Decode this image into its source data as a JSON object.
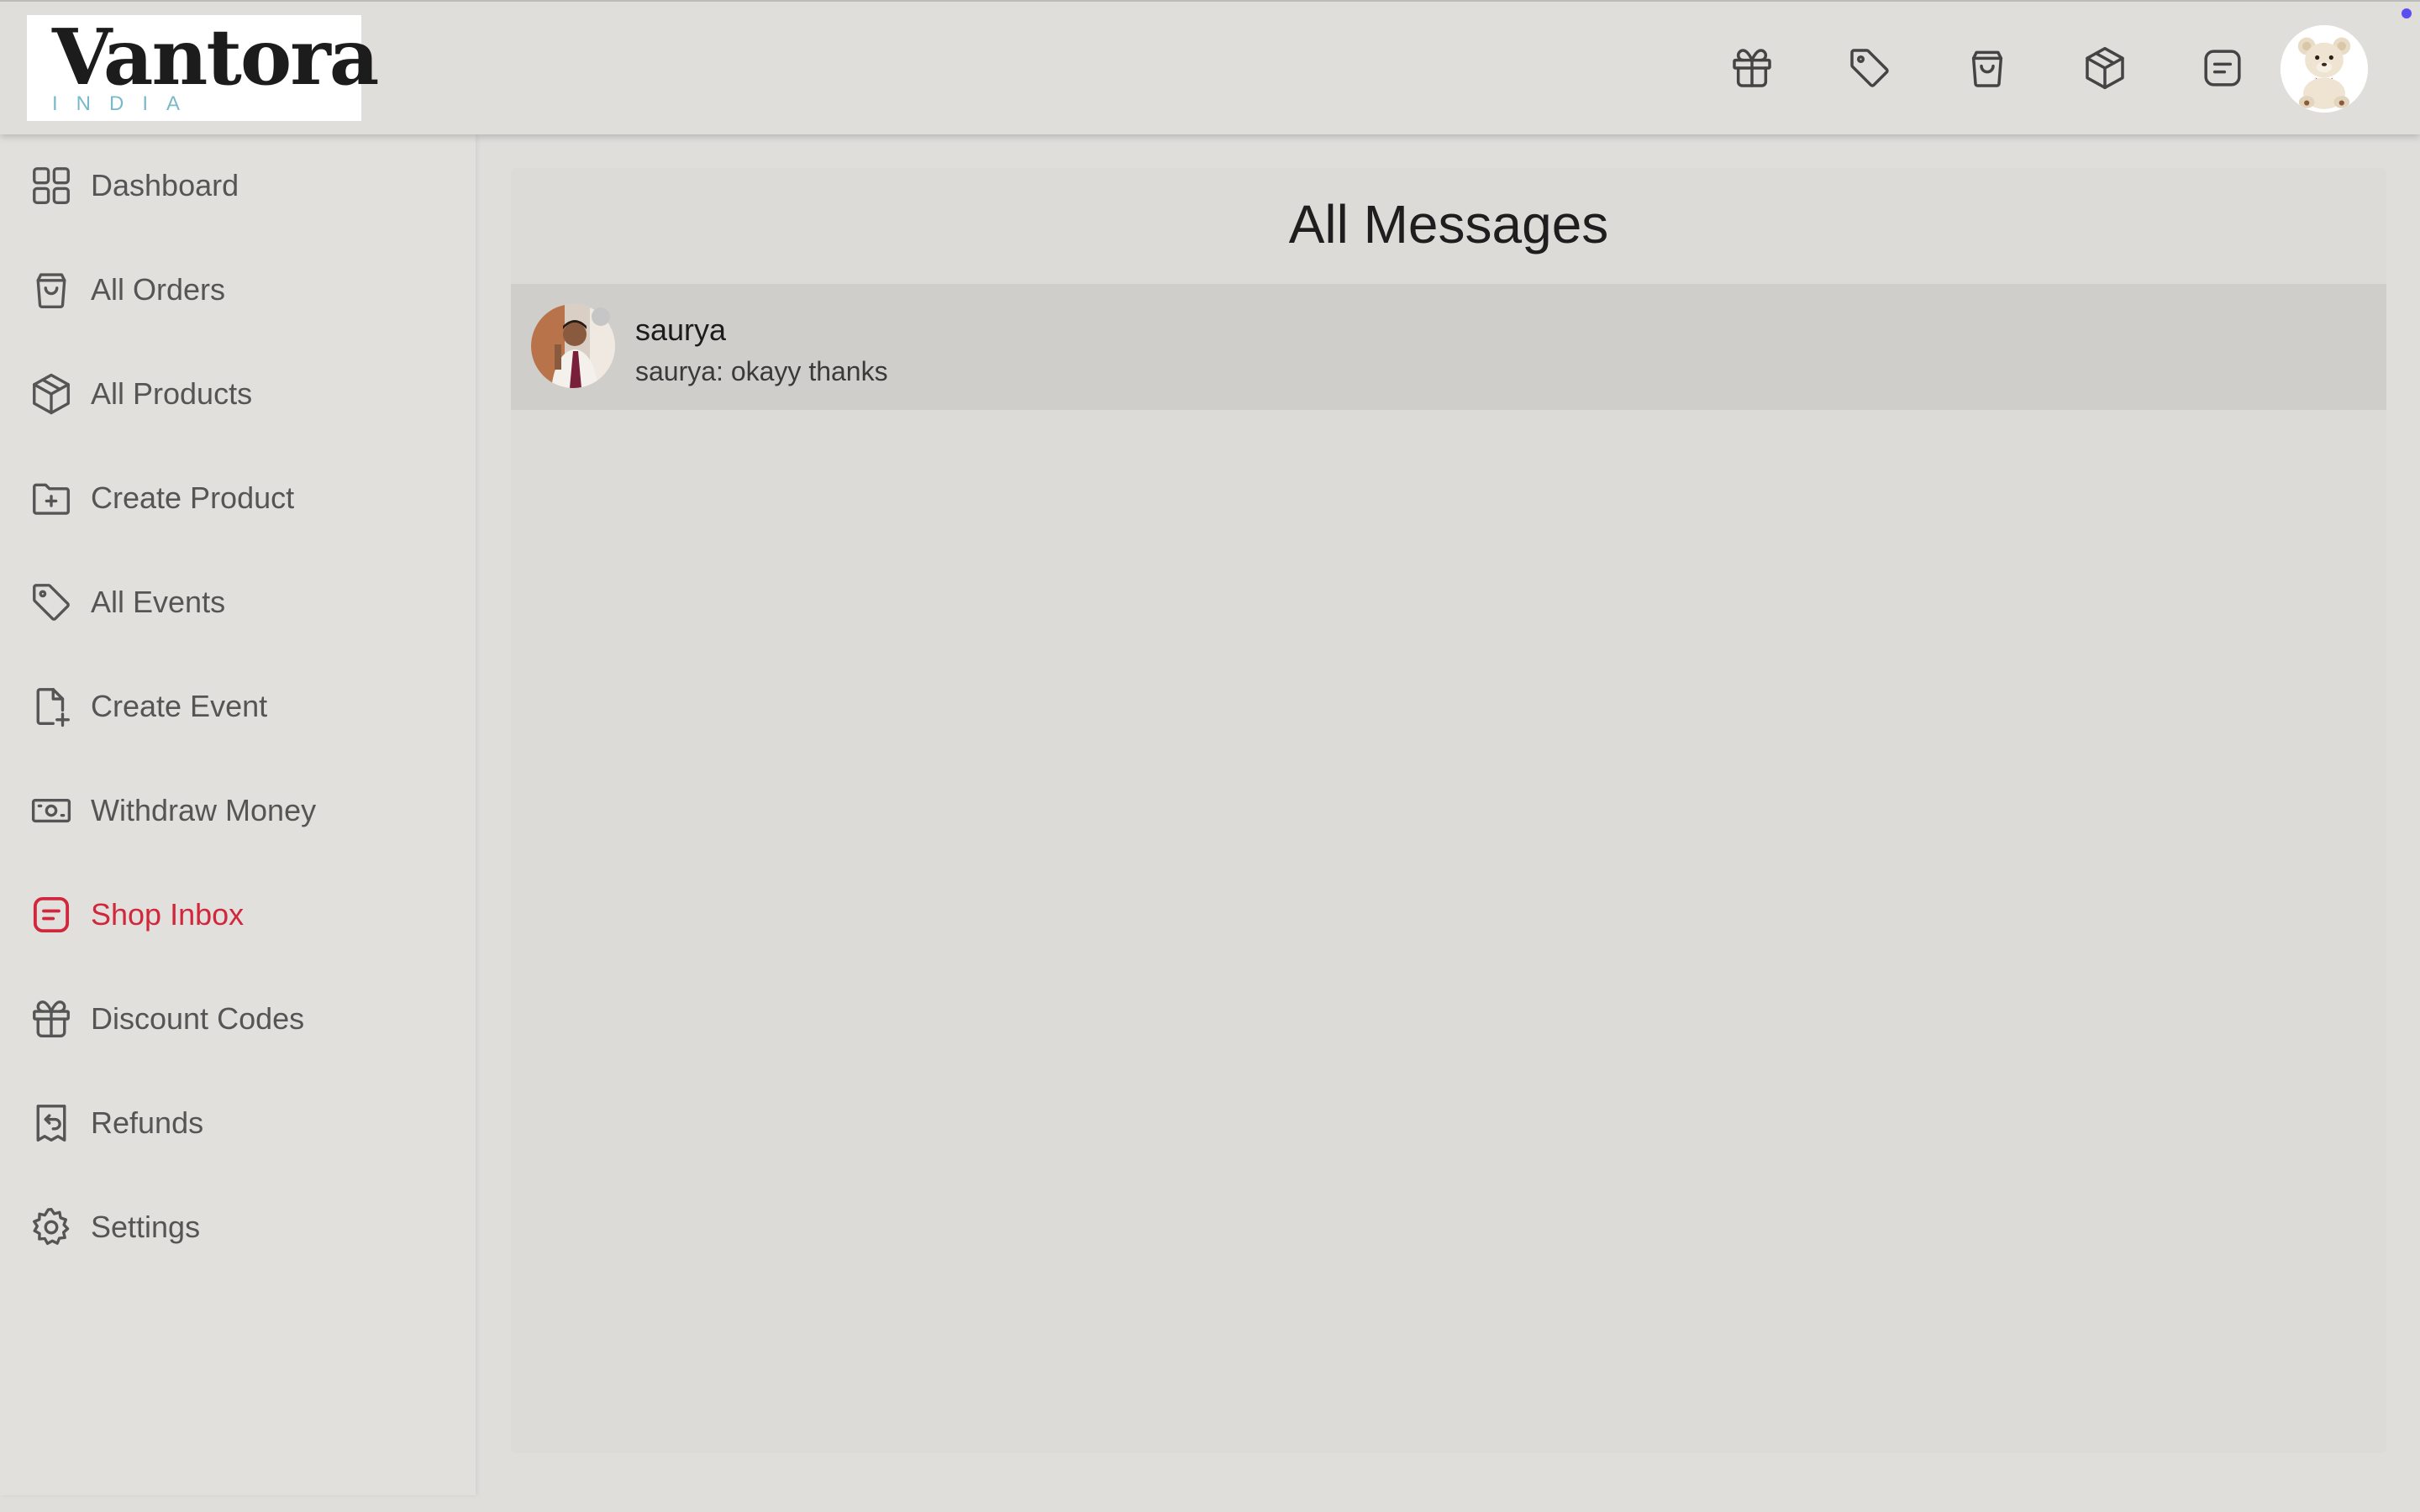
{
  "brand": {
    "name": "Vantora",
    "tagline": "INDIA"
  },
  "header": {
    "icons": [
      {
        "name": "gift-icon",
        "target": "Discount Codes"
      },
      {
        "name": "tag-icon",
        "target": "All Events"
      },
      {
        "name": "shopping-bag-icon",
        "target": "All Orders"
      },
      {
        "name": "box-icon",
        "target": "All Products"
      },
      {
        "name": "message-icon",
        "target": "Shop Inbox"
      }
    ],
    "avatar": "teddy-bear-avatar"
  },
  "sidebar": {
    "items": [
      {
        "label": "Dashboard",
        "icon": "grid-icon"
      },
      {
        "label": "All Orders",
        "icon": "shopping-bag-icon"
      },
      {
        "label": "All Products",
        "icon": "box-icon"
      },
      {
        "label": "Create Product",
        "icon": "folder-plus-icon"
      },
      {
        "label": "All Events",
        "icon": "tag-icon"
      },
      {
        "label": "Create Event",
        "icon": "file-plus-icon"
      },
      {
        "label": "Withdraw Money",
        "icon": "cash-icon"
      },
      {
        "label": "Shop Inbox",
        "icon": "message-icon",
        "active": true
      },
      {
        "label": "Discount Codes",
        "icon": "gift-icon"
      },
      {
        "label": "Refunds",
        "icon": "receipt-refund-icon"
      },
      {
        "label": "Settings",
        "icon": "gear-icon"
      }
    ]
  },
  "main": {
    "title": "All Messages",
    "conversations": [
      {
        "name": "saurya",
        "last_message": "saurya: okayy thanks",
        "online": false
      }
    ]
  },
  "colors": {
    "active": "#d1263b",
    "background": "#dfdedb",
    "row_highlight": "#cfcecb"
  }
}
